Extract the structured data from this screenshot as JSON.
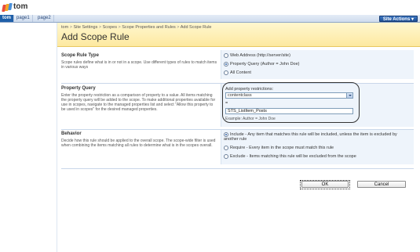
{
  "site": {
    "title": "tom"
  },
  "tabs": [
    "tom",
    "page1",
    "page2"
  ],
  "site_actions_label": "Site Actions",
  "site_actions_arrow": "▾",
  "breadcrumb": [
    "tom",
    "Site Settings",
    "Scopes",
    "Scope Properties and Rules",
    "Add Scope Rule"
  ],
  "breadcrumb_sep": ">",
  "page_title": "Add Scope Rule",
  "scope_rule_type": {
    "title": "Scope Rule Type",
    "description": "Scope rules define what is in or not in a scope. Use different types of rules to match items in various ways",
    "options": [
      {
        "label": "Web Address (http://server/site)",
        "checked": false
      },
      {
        "label": "Property Query (Author = John Doe)",
        "checked": true
      },
      {
        "label": "All Content",
        "checked": false
      }
    ]
  },
  "property_query": {
    "title": "Property Query",
    "description": "Enter the property restriction as a comparison of property to a value. All items matching the property query will be added to the scope. To make additional properties available for use in scopes, navigate to the managed properties list and select \"Allow this property to be used in scopes\" for the desired managed properties.",
    "add_label": "Add property restrictions:",
    "selected_property": "contentclass",
    "equals": "=",
    "value": "STS_ListItem_Posts",
    "example": "Example: Author = John Doe"
  },
  "behavior": {
    "title": "Behavior",
    "description": "Decide how this rule should be applied to the overall scope. The scope-wide filter is used when combining the items matching all rules to determine what is in the scopes overall.",
    "options": [
      {
        "label": "Include - Any item that matches this rule will be included, unless the item is excluded by another rule",
        "checked": true
      },
      {
        "label": "Require - Every item in the scope must match this rule",
        "checked": false
      },
      {
        "label": "Exclude - Items matching this rule will be excluded from the scope",
        "checked": false
      }
    ]
  },
  "buttons": {
    "ok": "OK",
    "cancel": "Cancel"
  },
  "colors": {
    "tab_active": "#1f5fa8",
    "title_band": "#fde9a0",
    "panel_bg": "#eef4fb",
    "logo": [
      "#e84c3d",
      "#f5a623",
      "#4a90d9"
    ]
  }
}
